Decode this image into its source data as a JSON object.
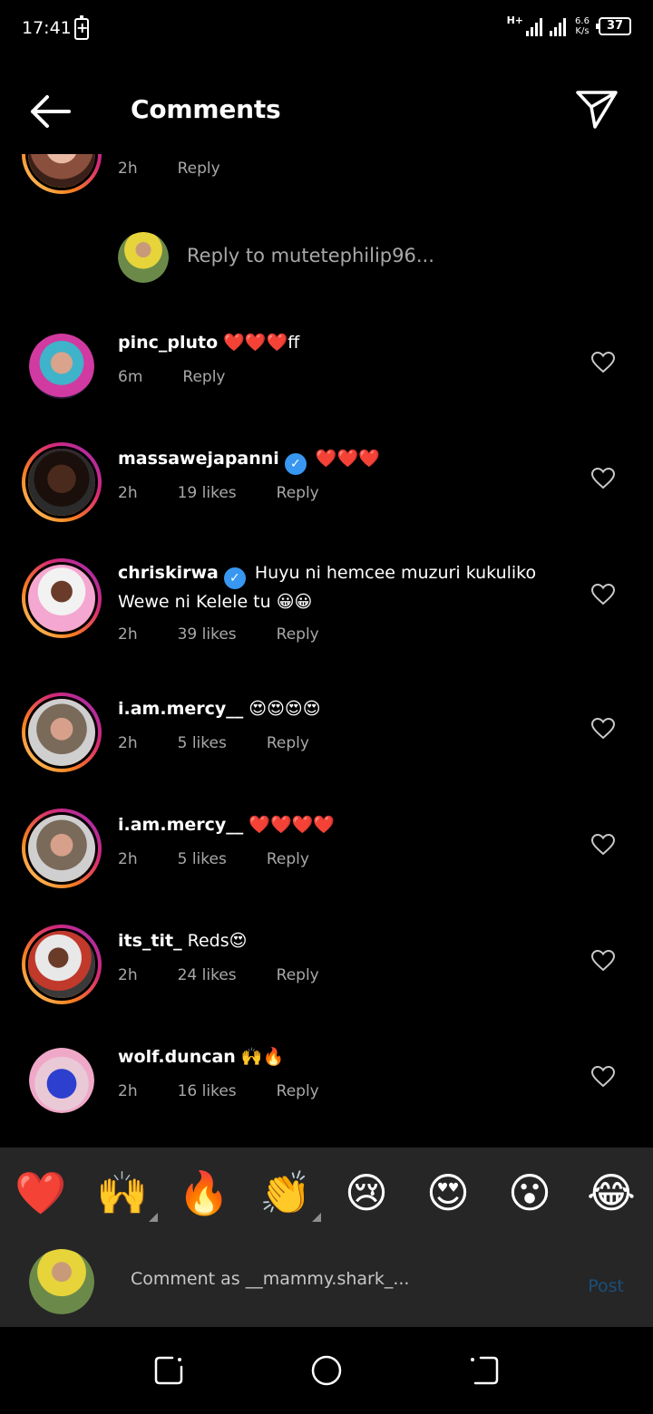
{
  "status_bar": {
    "time": "17:41",
    "net_speed_value": "6.6",
    "net_speed_unit": "K/s",
    "network_type": "H+",
    "battery_level": "37"
  },
  "header": {
    "title": "Comments"
  },
  "top_comment_partial": {
    "time": "2h",
    "reply_label": "Reply"
  },
  "reply_prompt": {
    "text": "Reply to mutetephilip96..."
  },
  "comments": [
    {
      "username": "pinc_pluto",
      "text": "❤️❤️❤️ff",
      "time": "6m",
      "likes": "",
      "reply_label": "Reply",
      "verified": false
    },
    {
      "username": "massawejapanni",
      "text": "❤️❤️❤️",
      "time": "2h",
      "likes": "19 likes",
      "reply_label": "Reply",
      "verified": true
    },
    {
      "username": "chriskirwa",
      "text": "Huyu ni hemcee muzuri kukuliko Wewe ni Kelele tu 😀😀",
      "time": "2h",
      "likes": "39 likes",
      "reply_label": "Reply",
      "verified": true
    },
    {
      "username": "i.am.mercy__",
      "text": "😍😍😍😍",
      "time": "2h",
      "likes": "5 likes",
      "reply_label": "Reply",
      "verified": false
    },
    {
      "username": "i.am.mercy__",
      "text": "❤️❤️❤️❤️",
      "time": "2h",
      "likes": "5 likes",
      "reply_label": "Reply",
      "verified": false
    },
    {
      "username": "its_tit_",
      "text": "Reds😍",
      "time": "2h",
      "likes": "24 likes",
      "reply_label": "Reply",
      "verified": false
    },
    {
      "username": "wolf.duncan",
      "text": "🙌🔥",
      "time": "2h",
      "likes": "16 likes",
      "reply_label": "Reply",
      "verified": false
    }
  ],
  "reactions": [
    "❤️",
    "🙌",
    "🔥",
    "👏",
    "😢",
    "😍",
    "😮",
    "😂"
  ],
  "composer": {
    "placeholder": "Comment as __mammy.shark_...",
    "post_label": "Post"
  },
  "colors": {
    "background": "#000000",
    "panel": "#262626",
    "meta_text": "#a8a8a8",
    "verified": "#3897f0",
    "post_disabled": "#1a4e7a"
  }
}
